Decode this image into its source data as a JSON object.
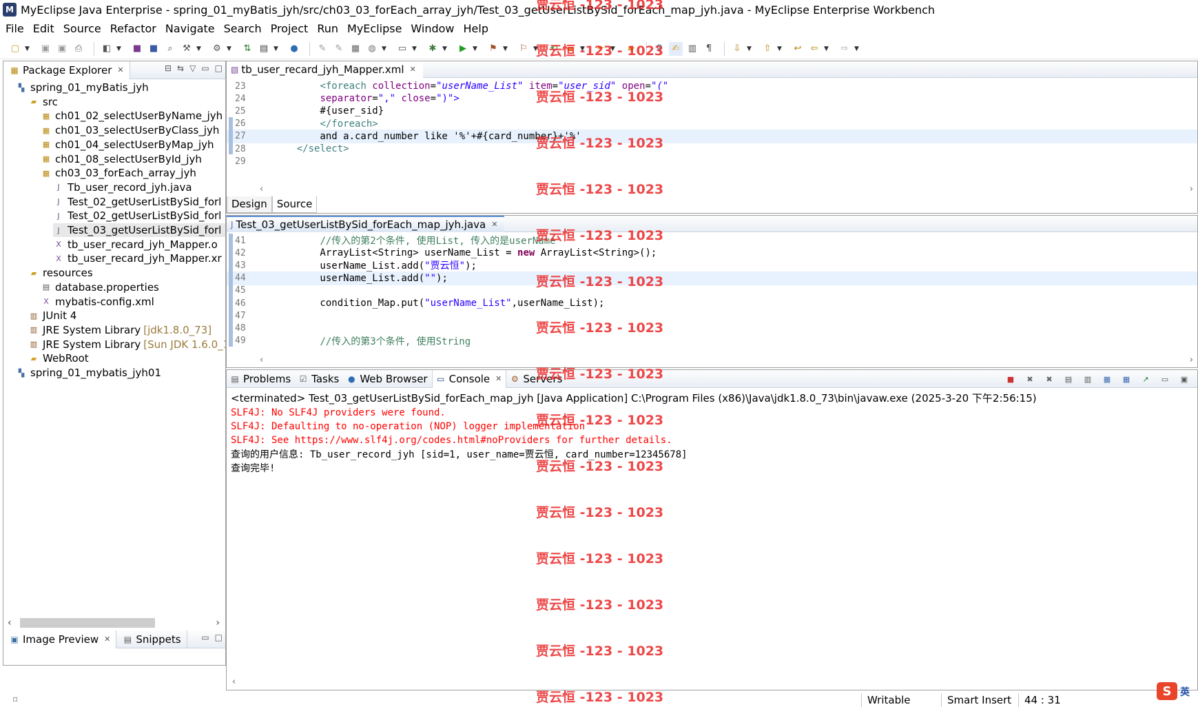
{
  "window": {
    "title": "MyEclipse Java Enterprise - spring_01_myBatis_jyh/src/ch03_03_forEach_array_jyh/Test_03_getUserListBySid_forEach_map_jyh.java - MyEclipse Enterprise Workbench",
    "app_icon": "myeclipse-logo-icon"
  },
  "menu": [
    "File",
    "Edit",
    "Source",
    "Refactor",
    "Navigate",
    "Search",
    "Project",
    "Run",
    "MyEclipse",
    "Window",
    "Help"
  ],
  "package_explorer": {
    "tab_label": "Package Explorer",
    "tree": [
      {
        "label": "spring_01_myBatis_jyh",
        "icon": "project-icon",
        "level": 0,
        "kind": "proj"
      },
      {
        "label": "src",
        "icon": "source-folder-icon",
        "level": 1,
        "kind": "pkg"
      },
      {
        "label": "ch01_02_selectUserByName_jyh",
        "icon": "package-icon",
        "level": 2,
        "kind": "pkg"
      },
      {
        "label": "ch01_03_selectUserByClass_jyh",
        "icon": "package-icon",
        "level": 2,
        "kind": "pkg"
      },
      {
        "label": "ch01_04_selectUserByMap_jyh",
        "icon": "package-icon",
        "level": 2,
        "kind": "pkg"
      },
      {
        "label": "ch01_08_selectUserById_jyh",
        "icon": "package-icon",
        "level": 2,
        "kind": "pkg"
      },
      {
        "label": "ch03_03_forEach_array_jyh",
        "icon": "package-icon",
        "level": 2,
        "kind": "pkg"
      },
      {
        "label": "Tb_user_record_jyh.java",
        "icon": "java-file-icon",
        "level": 3,
        "kind": "jfile"
      },
      {
        "label": "Test_02_getUserListBySid_forl",
        "icon": "java-file-icon",
        "level": 3,
        "kind": "jfile"
      },
      {
        "label": "Test_02_getUserListBySid_forl",
        "icon": "java-file-icon",
        "level": 3,
        "kind": "jfile"
      },
      {
        "label": "Test_03_getUserListBySid_forl",
        "icon": "java-file-icon",
        "level": 3,
        "kind": "jfile",
        "selected": true
      },
      {
        "label": "tb_user_recard_jyh_Mapper.o",
        "icon": "xml-file-icon",
        "level": 3,
        "kind": "xfile"
      },
      {
        "label": "tb_user_recard_jyh_Mapper.xr",
        "icon": "xml-file-icon",
        "level": 3,
        "kind": "xfile"
      },
      {
        "label": "resources",
        "icon": "source-folder-icon",
        "level": 1,
        "kind": "pkg"
      },
      {
        "label": "database.properties",
        "icon": "properties-file-icon",
        "level": 2,
        "kind": "jfile"
      },
      {
        "label": "mybatis-config.xml",
        "icon": "xml-file-icon",
        "level": 2,
        "kind": "xfile"
      },
      {
        "label": "JUnit 4",
        "icon": "library-icon",
        "level": 1,
        "kind": "lib"
      },
      {
        "label": "JRE System Library",
        "decor": "[jdk1.8.0_73]",
        "icon": "library-icon",
        "level": 1,
        "kind": "lib"
      },
      {
        "label": "JRE System Library",
        "decor": "[Sun JDK 1.6.0_1",
        "icon": "library-icon",
        "level": 1,
        "kind": "lib"
      },
      {
        "label": "WebRoot",
        "icon": "folder-icon",
        "level": 1,
        "kind": "pkg"
      },
      {
        "label": "spring_01_mybatis_jyh01",
        "icon": "project-icon",
        "level": 0,
        "kind": "proj"
      }
    ],
    "bottom_tabs": [
      "Image Preview",
      "Snippets"
    ]
  },
  "xml_editor": {
    "tab_label": "tb_user_recard_jyh_Mapper.xml",
    "lines": [
      {
        "n": "23",
        "parts": [
          [
            "",
            "        "
          ],
          [
            "c-tag",
            "<foreach "
          ],
          [
            "c-attr",
            "collection"
          ],
          [
            "",
            "="
          ],
          [
            "c-val",
            "\"userName_List\""
          ],
          [
            "",
            " "
          ],
          [
            "c-attr",
            "item"
          ],
          [
            "",
            "="
          ],
          [
            "c-val",
            "\"user_sid\""
          ],
          [
            "",
            " "
          ],
          [
            "c-attr",
            "open"
          ],
          [
            "",
            "="
          ],
          [
            "c-val",
            "\"(\""
          ]
        ]
      },
      {
        "n": "24",
        "parts": [
          [
            "",
            "        "
          ],
          [
            "c-attr",
            "separator"
          ],
          [
            "",
            "="
          ],
          [
            "c-str",
            "\",\""
          ],
          [
            "",
            " "
          ],
          [
            "c-attr",
            "close"
          ],
          [
            "",
            "="
          ],
          [
            "c-str",
            "\")\">"
          ]
        ]
      },
      {
        "n": "25",
        "parts": [
          [
            "",
            "        #{user_sid}"
          ]
        ]
      },
      {
        "n": "26",
        "parts": [
          [
            "",
            "        "
          ],
          [
            "c-tag",
            "</foreach>"
          ]
        ]
      },
      {
        "n": "27",
        "parts": [
          [
            "",
            "        and a.card_number like '%'+#{card_number}+'%'"
          ]
        ],
        "current": true
      },
      {
        "n": "28",
        "parts": [
          [
            "",
            "    "
          ],
          [
            "c-tag",
            "</select>"
          ]
        ]
      },
      {
        "n": "29",
        "parts": [
          [
            "",
            ""
          ]
        ]
      }
    ],
    "bottom_tabs": [
      "Design",
      "Source"
    ]
  },
  "java_editor": {
    "tab_label": "Test_03_getUserListBySid_forEach_map_jyh.java",
    "lines": [
      {
        "n": "41",
        "parts": [
          [
            "",
            "        "
          ],
          [
            "c-cmt",
            "//传入的第2个条件, 使用List, 传入的是userName"
          ]
        ]
      },
      {
        "n": "42",
        "parts": [
          [
            "",
            "        ArrayList<String> userName_List = "
          ],
          [
            "c-kw",
            "new"
          ],
          [
            "",
            " ArrayList<String>();"
          ]
        ]
      },
      {
        "n": "43",
        "parts": [
          [
            "",
            "        userName_List.add("
          ],
          [
            "c-str",
            "\"贾云恒\""
          ],
          [
            "",
            ");"
          ]
        ]
      },
      {
        "n": "44",
        "parts": [
          [
            "",
            "        userName_List.add("
          ],
          [
            "c-str",
            "\"\""
          ],
          [
            "",
            ");"
          ]
        ],
        "current": true
      },
      {
        "n": "45",
        "parts": [
          [
            "",
            ""
          ]
        ]
      },
      {
        "n": "46",
        "parts": [
          [
            "",
            "        condition_Map.put("
          ],
          [
            "c-str",
            "\"userName_List\""
          ],
          [
            "",
            ",userName_List);"
          ]
        ]
      },
      {
        "n": "47",
        "parts": [
          [
            "",
            ""
          ]
        ]
      },
      {
        "n": "48",
        "parts": [
          [
            "",
            ""
          ]
        ]
      },
      {
        "n": "49",
        "parts": [
          [
            "",
            "        "
          ],
          [
            "c-cmt",
            "//传入的第3个条件, 使用String"
          ]
        ]
      }
    ]
  },
  "console": {
    "tabs": [
      {
        "label": "Problems",
        "icon": "problems-icon"
      },
      {
        "label": "Tasks",
        "icon": "tasks-icon"
      },
      {
        "label": "Web Browser",
        "icon": "globe-icon"
      },
      {
        "label": "Console",
        "icon": "console-icon",
        "active": true
      },
      {
        "label": "Servers",
        "icon": "servers-icon"
      }
    ],
    "status": "<terminated> Test_03_getUserListBySid_forEach_map_jyh [Java Application] C:\\Program Files (x86)\\Java\\jdk1.8.0_73\\bin\\javaw.exe (2025-3-20 下午2:56:15)",
    "output": [
      {
        "text": "SLF4J: No SLF4J providers were found.",
        "err": true
      },
      {
        "text": "SLF4J: Defaulting to no-operation (NOP) logger implementation",
        "err": true
      },
      {
        "text": "SLF4J: See https://www.slf4j.org/codes.html#noProviders for further details.",
        "err": true
      },
      {
        "text": "查询的用户信息: Tb_user_record_jyh [sid=1, user_name=贾云恒, card_number=12345678]",
        "err": false
      },
      {
        "text": "查询完毕!",
        "err": false
      }
    ]
  },
  "statusbar": {
    "writable": "Writable",
    "insert_mode": "Smart Insert",
    "position": "44 : 31",
    "ime_badge": "S",
    "ime_lang": "英"
  },
  "watermark": {
    "text": "贾云恒 -123 - 1023",
    "count": 16,
    "color": "#eb2828"
  }
}
